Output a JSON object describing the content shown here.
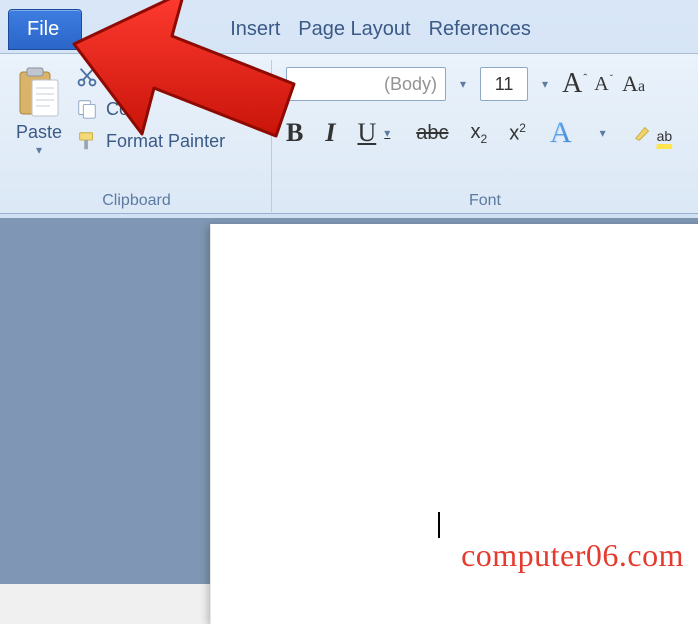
{
  "tabs": {
    "file": "File",
    "insert": "Insert",
    "page_layout": "Page Layout",
    "references": "References"
  },
  "clipboard": {
    "paste": "Paste",
    "copy": "Co",
    "format_painter": "Format Painter",
    "group_label": "Clipboard"
  },
  "font": {
    "name_partial": "(Body)",
    "size": "11",
    "group_label": "Font",
    "bold": "B",
    "italic": "I",
    "underline": "U",
    "strike": "abc",
    "subscript_base": "x",
    "subscript_sub": "2",
    "superscript_base": "x",
    "superscript_sup": "2",
    "grow_A": "A",
    "shrink_A": "A",
    "case_A": "A",
    "case_a": "a",
    "effects_A": "A",
    "highlight_ab": "ab"
  },
  "watermark": "computer06.com"
}
